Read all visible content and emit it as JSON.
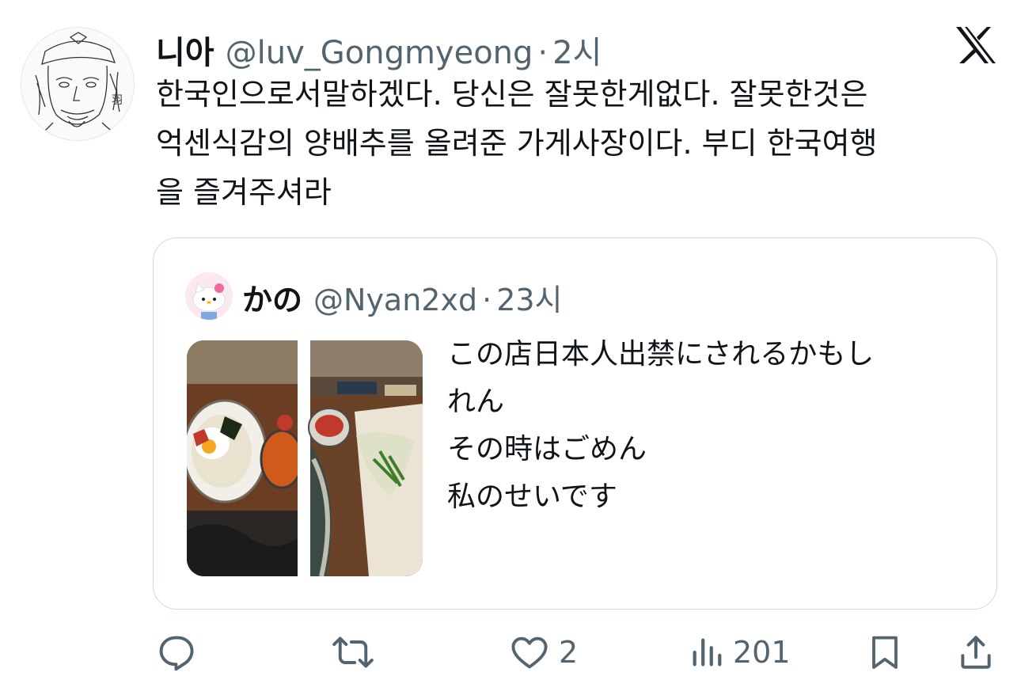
{
  "tweet": {
    "author": {
      "display_name": "니아",
      "handle": "@luv_Gongmyeong",
      "separator": "·",
      "time": "2시",
      "avatar_icon": "sketch-portrait-avatar"
    },
    "brand_icon": "x-logo-icon",
    "text_lines": [
      "한국인으로서말하겠다. 당신은 잘못한게없다. 잘못한것은",
      "억센식감의 양배추를 올려준 가게사장이다. 부디 한국여행",
      "을 즐겨주셔라"
    ]
  },
  "quote": {
    "author": {
      "display_name": "かの",
      "handle": "@Nyan2xd",
      "separator": "·",
      "time": "23시",
      "avatar_icon": "hello-kitty-avatar"
    },
    "text_lines": [
      "この店日本人出禁にされるかもし",
      "れん",
      "その時はごめん",
      "私のせいです"
    ],
    "media": {
      "description_icon": "food-photo-thumbnail",
      "count": 2
    }
  },
  "actions": {
    "reply": {
      "icon": "reply-icon",
      "count": ""
    },
    "retweet": {
      "icon": "retweet-icon",
      "count": ""
    },
    "like": {
      "icon": "heart-icon",
      "count": "2"
    },
    "views": {
      "icon": "views-icon",
      "count": "201"
    },
    "bookmark": {
      "icon": "bookmark-icon",
      "count": ""
    },
    "share": {
      "icon": "share-icon",
      "count": ""
    }
  },
  "colors": {
    "text_primary": "#0f1419",
    "text_secondary": "#536471",
    "border": "#cfd9de"
  }
}
